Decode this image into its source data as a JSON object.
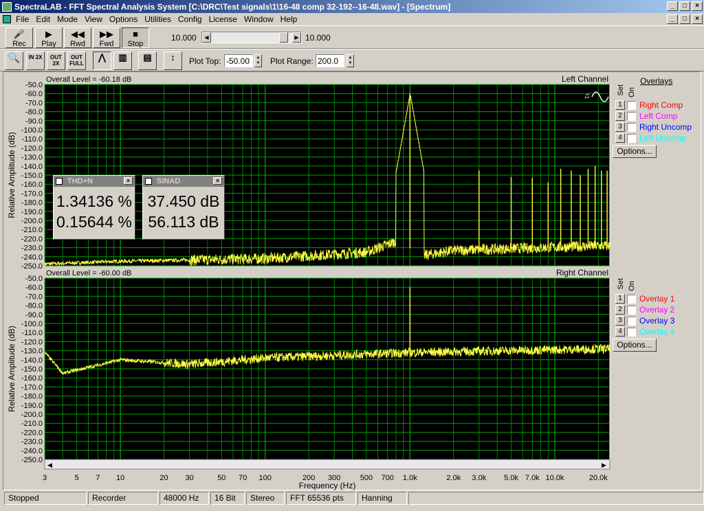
{
  "window": {
    "title": "SpectraLAB - FFT Spectral Analysis System [C:\\DRC\\Test signals\\1\\16-48 comp 32-192--16-48.wav] - [Spectrum]"
  },
  "menu": [
    "File",
    "Edit",
    "Mode",
    "View",
    "Options",
    "Utilities",
    "Config",
    "License",
    "Window",
    "Help"
  ],
  "transport": {
    "rec": "Rec",
    "play": "Play",
    "rwd": "Rwd",
    "fwd": "Fwd",
    "stop": "Stop",
    "slider_left": "10.000",
    "slider_right": "10.000"
  },
  "toolbar2": {
    "plot_top_label": "Plot Top:",
    "plot_top_value": "-50.00",
    "plot_range_label": "Plot Range:",
    "plot_range_value": "200.0",
    "btn_in2x": "IN 2X",
    "btn_out2x": "OUT 2X",
    "btn_outfull": "OUT FULL"
  },
  "top_plot": {
    "overall_level": "Overall Level = -60.18 dB",
    "channel": "Left Channel",
    "ylabel": "Relative Amplitude (dB)"
  },
  "bottom_plot": {
    "overall_level": "Overall Level = -60.00 dB",
    "channel": "Right Channel",
    "ylabel": "Relative Amplitude (dB)"
  },
  "xlabel": "Frequency (Hz)",
  "yticks": [
    "-50.0",
    "-60.0",
    "-70.0",
    "-80.0",
    "-90.0",
    "-100.0",
    "-110.0",
    "-120.0",
    "-130.0",
    "-140.0",
    "-150.0",
    "-160.0",
    "-170.0",
    "-180.0",
    "-190.0",
    "-200.0",
    "-210.0",
    "-220.0",
    "-230.0",
    "-240.0",
    "-250.0"
  ],
  "xticks": [
    {
      "f": 3,
      "label": "3"
    },
    {
      "f": 5,
      "label": "5"
    },
    {
      "f": 7,
      "label": "7"
    },
    {
      "f": 10,
      "label": "10"
    },
    {
      "f": 20,
      "label": "20"
    },
    {
      "f": 30,
      "label": "30"
    },
    {
      "f": 50,
      "label": "50"
    },
    {
      "f": 70,
      "label": "70"
    },
    {
      "f": 100,
      "label": "100"
    },
    {
      "f": 200,
      "label": "200"
    },
    {
      "f": 300,
      "label": "300"
    },
    {
      "f": 500,
      "label": "500"
    },
    {
      "f": 700,
      "label": "700"
    },
    {
      "f": 1000,
      "label": "1.0k"
    },
    {
      "f": 2000,
      "label": "2.0k"
    },
    {
      "f": 3000,
      "label": "3.0k"
    },
    {
      "f": 5000,
      "label": "5.0k"
    },
    {
      "f": 7000,
      "label": "7.0k"
    },
    {
      "f": 10000,
      "label": "10.0k"
    },
    {
      "f": 20000,
      "label": "20.0k"
    }
  ],
  "thd": {
    "title": "THD+N",
    "v1": "1.34136 %",
    "v2": "0.15644 %"
  },
  "sinad": {
    "title": "SINAD",
    "v1": "37.450 dB",
    "v2": "56.113 dB"
  },
  "overlays_top": {
    "header": "Overlays",
    "set": "Set",
    "on": "On",
    "items": [
      {
        "n": "1",
        "label": "Right Comp",
        "color": "#ff0000"
      },
      {
        "n": "2",
        "label": "Left Comp",
        "color": "#ff00ff"
      },
      {
        "n": "3",
        "label": "Right Uncomp",
        "color": "#0000ff"
      },
      {
        "n": "4",
        "label": "Left Uncomp",
        "color": "#00ffff"
      }
    ],
    "options": "Options..."
  },
  "overlays_bottom": {
    "set": "Set",
    "on": "On",
    "items": [
      {
        "n": "1",
        "label": "Overlay 1",
        "color": "#ff0000"
      },
      {
        "n": "2",
        "label": "Overlay 2",
        "color": "#ff00ff"
      },
      {
        "n": "3",
        "label": "Overlay 3",
        "color": "#0000ff"
      },
      {
        "n": "4",
        "label": "Overlay 4",
        "color": "#00ffff"
      }
    ],
    "options": "Options..."
  },
  "status": [
    "Stopped",
    "Recorder",
    "48000 Hz",
    "16 Bit",
    "Stereo",
    "FFT 65536 pts",
    "Hanning"
  ],
  "colors": {
    "plot_bg": "#000000",
    "grid": "#00a000",
    "trace": "#ffff40"
  },
  "chart_data": [
    {
      "type": "line",
      "name": "Left Channel",
      "xscale": "log",
      "xlim": [
        3,
        24000
      ],
      "ylim": [
        -250,
        -50
      ],
      "peaks": [
        {
          "x": 1000,
          "y": -60
        },
        {
          "x": 3000,
          "y": -145
        },
        {
          "x": 5000,
          "y": -152
        },
        {
          "x": 7000,
          "y": -153
        },
        {
          "x": 9000,
          "y": -158
        },
        {
          "x": 11000,
          "y": -143
        },
        {
          "x": 13000,
          "y": -145
        },
        {
          "x": 15000,
          "y": -150
        },
        {
          "x": 17000,
          "y": -143
        },
        {
          "x": 19000,
          "y": -140
        },
        {
          "x": 21000,
          "y": -145
        },
        {
          "x": 23000,
          "y": -145
        }
      ],
      "noise_floor": [
        [
          3,
          -248
        ],
        [
          10,
          -245
        ],
        [
          100,
          -242
        ],
        [
          500,
          -235
        ],
        [
          900,
          -220
        ],
        [
          1100,
          -240
        ],
        [
          2000,
          -233
        ],
        [
          20000,
          -228
        ]
      ]
    },
    {
      "type": "line",
      "name": "Right Channel",
      "xscale": "log",
      "xlim": [
        3,
        24000
      ],
      "ylim": [
        -250,
        -50
      ],
      "peaks": [
        {
          "x": 1000,
          "y": -60
        }
      ],
      "noise_floor": [
        [
          3,
          -132
        ],
        [
          4,
          -155
        ],
        [
          10,
          -140
        ],
        [
          30,
          -145
        ],
        [
          100,
          -138
        ],
        [
          1000,
          -132
        ],
        [
          20000,
          -128
        ]
      ]
    }
  ]
}
